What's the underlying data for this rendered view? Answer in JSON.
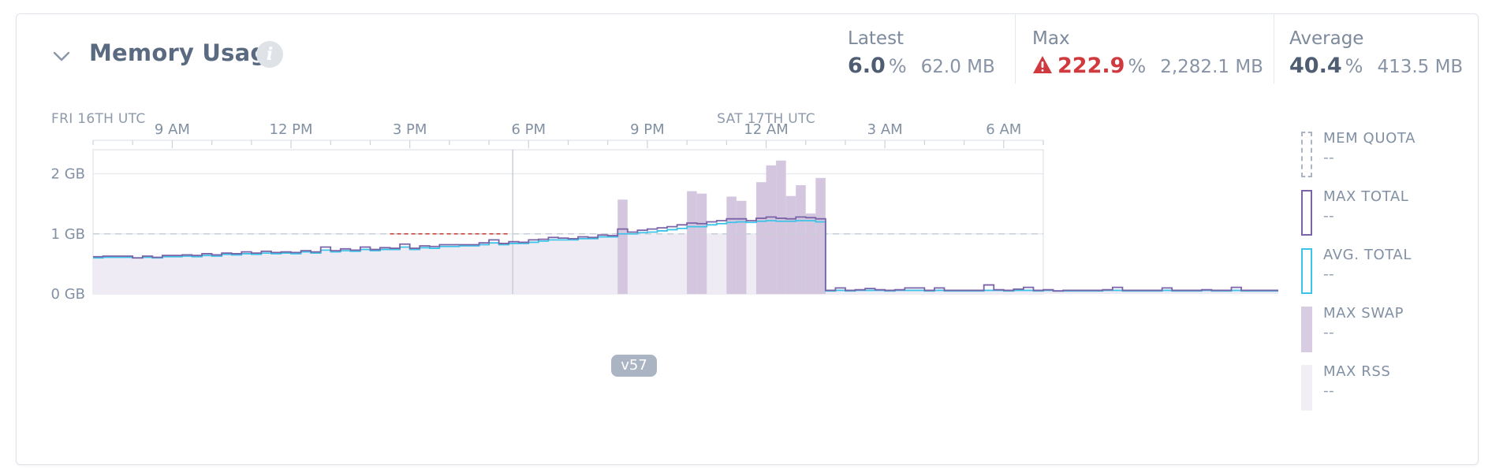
{
  "panel": {
    "title": "Memory Usage",
    "info_icon": "info-icon",
    "toggle_icon": "chevron-down-icon"
  },
  "stats": {
    "latest": {
      "label": "Latest",
      "percent": "6.0",
      "unit": "%",
      "mb": "62.0 MB"
    },
    "max": {
      "label": "Max",
      "percent": "222.9",
      "unit": "%",
      "mb": "2,282.1 MB",
      "icon": "warning-icon"
    },
    "average": {
      "label": "Average",
      "percent": "40.4",
      "unit": "%",
      "mb": "413.5 MB"
    }
  },
  "legend": [
    {
      "name": "MEM QUOTA",
      "value": "--",
      "style": "dashed",
      "color": "#aab4c3"
    },
    {
      "name": "MAX TOTAL",
      "value": "--",
      "style": "outline",
      "color": "#7b63a8"
    },
    {
      "name": "AVG. TOTAL",
      "value": "--",
      "style": "outline",
      "color": "#3cc4e8"
    },
    {
      "name": "MAX SWAP",
      "value": "--",
      "style": "fill",
      "color": "#d8cce2"
    },
    {
      "name": "MAX RSS",
      "value": "--",
      "style": "fill",
      "color": "#f1eef6"
    }
  ],
  "release_badge": "v57",
  "colors": {
    "max_total": "#7b63a8",
    "avg_total": "#3cc4e8",
    "swap": "#d3c6de",
    "rss": "#efebf4",
    "quota_line": "#c8ced8",
    "over_quota": "#c0392b",
    "grid": "#e5e8ed",
    "warning": "#d0393e"
  },
  "chart_data": {
    "type": "area",
    "date_labels": [
      "FRI 16TH UTC",
      "SAT 17TH UTC"
    ],
    "x_ticks": [
      "9 AM",
      "12 PM",
      "3 PM",
      "6 PM",
      "9 PM",
      "12 AM",
      "3 AM",
      "6 AM"
    ],
    "y_ticks": [
      "0 GB",
      "1 GB",
      "2 GB"
    ],
    "ylim_gb": [
      0,
      2.4
    ],
    "quota_gb": 1.0,
    "release_hours_after_7am": 10.6,
    "x_range_hours_after_7am": [
      0,
      24
    ],
    "bucket_hours": 0.25,
    "series": [
      {
        "name": "MAX TOTAL",
        "values": [
          0.62,
          0.63,
          0.63,
          0.63,
          0.6,
          0.63,
          0.61,
          0.64,
          0.64,
          0.65,
          0.64,
          0.67,
          0.65,
          0.68,
          0.67,
          0.7,
          0.68,
          0.71,
          0.69,
          0.7,
          0.69,
          0.72,
          0.7,
          0.78,
          0.72,
          0.75,
          0.73,
          0.78,
          0.74,
          0.77,
          0.76,
          0.83,
          0.76,
          0.8,
          0.79,
          0.82,
          0.82,
          0.82,
          0.82,
          0.85,
          0.9,
          0.84,
          0.87,
          0.86,
          0.9,
          0.91,
          0.94,
          0.93,
          0.92,
          0.95,
          0.94,
          0.98,
          0.97,
          1.08,
          1.03,
          1.06,
          1.08,
          1.1,
          1.12,
          1.15,
          1.18,
          1.17,
          1.2,
          1.22,
          1.25,
          1.25,
          1.22,
          1.26,
          1.28,
          1.26,
          1.25,
          1.28,
          1.27,
          1.25,
          0.06,
          0.1,
          0.06,
          0.07,
          0.09,
          0.07,
          0.06,
          0.07,
          0.1,
          0.1,
          0.06,
          0.1,
          0.06,
          0.06,
          0.06,
          0.06,
          0.15,
          0.07,
          0.06,
          0.08,
          0.11,
          0.06,
          0.07,
          0.05,
          0.06,
          0.06,
          0.06,
          0.06,
          0.07,
          0.11,
          0.06,
          0.06,
          0.06,
          0.06,
          0.1,
          0.06,
          0.06,
          0.06,
          0.07,
          0.06,
          0.06,
          0.11,
          0.06,
          0.06,
          0.06,
          0.06,
          0.06,
          0.06,
          0.06,
          0.1,
          0.06,
          0.07,
          0.06,
          0.07,
          0.06,
          0.06,
          0.06,
          0.06,
          0.1,
          0.06,
          0.06,
          0.06,
          0.06,
          0.06,
          0.07,
          0.11,
          0.06,
          0.06,
          0.07,
          0.06,
          0.06,
          0.06,
          0.08,
          0.06,
          0.1,
          0.07,
          0.06,
          0.06,
          0.06,
          0.06,
          0.06,
          0.06,
          0.1,
          0.06,
          0.06,
          0.08,
          0.07,
          0.06,
          0.07,
          0.06,
          0.06,
          0.1,
          0.06,
          0.06,
          0.07,
          0.06,
          0.06,
          0.05,
          0.05,
          0.05,
          0.06,
          0.06,
          0.06,
          0.06,
          0.06,
          0.06,
          0.06,
          0.06,
          0.08,
          0.07,
          0.06,
          0.06,
          0.06,
          0.06,
          0.06
        ]
      },
      {
        "name": "AVG. TOTAL",
        "values": [
          0.6,
          0.61,
          0.61,
          0.61,
          0.6,
          0.61,
          0.6,
          0.62,
          0.62,
          0.63,
          0.62,
          0.64,
          0.63,
          0.66,
          0.65,
          0.67,
          0.66,
          0.68,
          0.67,
          0.68,
          0.67,
          0.7,
          0.68,
          0.73,
          0.7,
          0.72,
          0.71,
          0.74,
          0.72,
          0.74,
          0.74,
          0.78,
          0.74,
          0.77,
          0.76,
          0.79,
          0.79,
          0.8,
          0.8,
          0.82,
          0.85,
          0.82,
          0.84,
          0.84,
          0.86,
          0.88,
          0.9,
          0.9,
          0.9,
          0.92,
          0.92,
          0.95,
          0.95,
          1.0,
          1.0,
          1.02,
          1.03,
          1.05,
          1.07,
          1.09,
          1.12,
          1.12,
          1.15,
          1.17,
          1.19,
          1.2,
          1.19,
          1.21,
          1.22,
          1.21,
          1.21,
          1.22,
          1.22,
          1.2,
          0.05,
          0.06,
          0.05,
          0.06,
          0.06,
          0.06,
          0.05,
          0.06,
          0.06,
          0.06,
          0.05,
          0.06,
          0.05,
          0.05,
          0.05,
          0.05,
          0.06,
          0.06,
          0.05,
          0.06,
          0.06,
          0.05,
          0.06,
          0.05,
          0.05,
          0.05,
          0.05,
          0.05,
          0.06,
          0.06,
          0.05,
          0.05,
          0.05,
          0.05,
          0.06,
          0.05,
          0.05,
          0.05,
          0.06,
          0.05,
          0.05,
          0.06,
          0.05,
          0.05,
          0.05,
          0.05,
          0.05,
          0.05,
          0.05,
          0.06,
          0.05,
          0.06,
          0.05,
          0.06,
          0.05,
          0.05,
          0.05,
          0.05,
          0.06,
          0.05,
          0.05,
          0.05,
          0.05,
          0.05,
          0.06,
          0.06,
          0.05,
          0.05,
          0.06,
          0.05,
          0.05,
          0.05,
          0.06,
          0.05,
          0.06,
          0.06,
          0.05,
          0.05,
          0.05,
          0.05,
          0.05,
          0.05,
          0.06,
          0.05,
          0.05,
          0.06,
          0.06,
          0.05,
          0.06,
          0.05,
          0.05,
          0.06,
          0.05,
          0.05,
          0.06,
          0.05,
          0.05,
          0.04,
          0.04,
          0.04,
          0.04,
          0.04,
          0.04,
          0.04,
          0.04,
          0.04,
          0.04,
          0.04,
          0.05,
          0.05,
          0.04,
          0.05,
          0.05,
          0.05,
          0.05
        ]
      },
      {
        "name": "MAX SWAP",
        "values": [
          0,
          0,
          0,
          0,
          0,
          0,
          0,
          0,
          0,
          0,
          0,
          0,
          0,
          0,
          0,
          0,
          0,
          0,
          0,
          0,
          0,
          0,
          0,
          0,
          0,
          0,
          0,
          0,
          0,
          0,
          0,
          0,
          0,
          0,
          0,
          0,
          0,
          0,
          0,
          0,
          0,
          0,
          0,
          0,
          0,
          0,
          0,
          0,
          0,
          0,
          0,
          0,
          0,
          1.57,
          0,
          0,
          0,
          0,
          0,
          0,
          1.71,
          1.67,
          0,
          0,
          1.62,
          1.55,
          0,
          1.86,
          2.14,
          2.22,
          1.63,
          1.81,
          1.34,
          1.93,
          0,
          0,
          0,
          0,
          0,
          0,
          0,
          0,
          0,
          0,
          0,
          0,
          0,
          0,
          0,
          0,
          0,
          0,
          0,
          0,
          0,
          0,
          0,
          0,
          0,
          0,
          0,
          0,
          0,
          0,
          0,
          0,
          0,
          0,
          0,
          0,
          0,
          0,
          0,
          0,
          0,
          0,
          0,
          0,
          0,
          0,
          0,
          0,
          0,
          0,
          0,
          0,
          0,
          0,
          0,
          0,
          0,
          0,
          0,
          0,
          0,
          0,
          0,
          0,
          0,
          0,
          0,
          0,
          0,
          0,
          0,
          0,
          0,
          0,
          0,
          0,
          0,
          0,
          0,
          0,
          0,
          0,
          0,
          0,
          0,
          0,
          0,
          0,
          0,
          0,
          0,
          0,
          0,
          0,
          0,
          0,
          0,
          0,
          0,
          0,
          0,
          0,
          0,
          0,
          0,
          0,
          0,
          0,
          0,
          0,
          0,
          0,
          0,
          0,
          0,
          0,
          0,
          0,
          0
        ]
      },
      {
        "name": "MAX RSS",
        "values": [
          0.6,
          0.61,
          0.61,
          0.61,
          0.6,
          0.61,
          0.6,
          0.62,
          0.62,
          0.63,
          0.62,
          0.64,
          0.63,
          0.66,
          0.65,
          0.67,
          0.66,
          0.68,
          0.67,
          0.68,
          0.67,
          0.7,
          0.68,
          0.73,
          0.7,
          0.72,
          0.71,
          0.74,
          0.72,
          0.74,
          0.74,
          0.78,
          0.74,
          0.77,
          0.76,
          0.79,
          0.79,
          0.8,
          0.8,
          0.82,
          0.85,
          0.82,
          0.84,
          0.84,
          0.86,
          0.88,
          0.9,
          0.9,
          0.9,
          0.92,
          0.92,
          0.95,
          0.95,
          1.0,
          1.0,
          1.0,
          1.0,
          1.0,
          1.0,
          1.0,
          1.0,
          1.0,
          1.0,
          1.0,
          1.0,
          1.0,
          1.0,
          1.0,
          1.0,
          1.0,
          1.0,
          1.0,
          1.0,
          1.0,
          0.05,
          0.06,
          0.05,
          0.06,
          0.06,
          0.06,
          0.05,
          0.06,
          0.06,
          0.06,
          0.05,
          0.06,
          0.05,
          0.05,
          0.05,
          0.05,
          0.06,
          0.06,
          0.05,
          0.06,
          0.06,
          0.05,
          0.06,
          0.05,
          0.05,
          0.05,
          0.05,
          0.05,
          0.06,
          0.06,
          0.05,
          0.05,
          0.05,
          0.05,
          0.06,
          0.05,
          0.05,
          0.05,
          0.06,
          0.05,
          0.05,
          0.06,
          0.05,
          0.05,
          0.05,
          0.05,
          0.05,
          0.05,
          0.05,
          0.06,
          0.05,
          0.06,
          0.05,
          0.06,
          0.05,
          0.05,
          0.05,
          0.05,
          0.06,
          0.05,
          0.05,
          0.05,
          0.05,
          0.05,
          0.06,
          0.06,
          0.05,
          0.05,
          0.06,
          0.05,
          0.05,
          0.05,
          0.06,
          0.05,
          0.06,
          0.06,
          0.05,
          0.05,
          0.05,
          0.05,
          0.05,
          0.05,
          0.06,
          0.05,
          0.05,
          0.06,
          0.06,
          0.05,
          0.06,
          0.05,
          0.05,
          0.06,
          0.05,
          0.05,
          0.06,
          0.05,
          0.05,
          0.04,
          0.04,
          0.04,
          0.04,
          0.04,
          0.04,
          0.04,
          0.04,
          0.04,
          0.04,
          0.04,
          0.05,
          0.05,
          0.04,
          0.05,
          0.05,
          0.05,
          0.05
        ]
      }
    ]
  }
}
